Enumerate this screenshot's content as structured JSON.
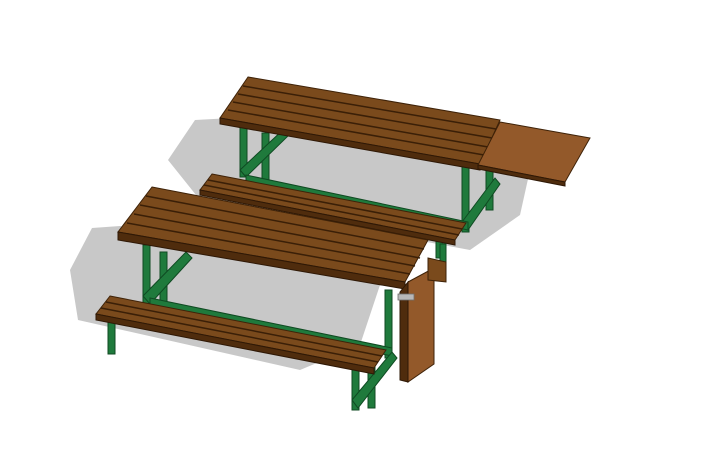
{
  "scene": {
    "subject": "",
    "colors": {
      "background": "#ffffff",
      "wood": "#7a4a1c",
      "wood_dark": "#4f2c0d",
      "wood_light": "#93592a",
      "frame": "#1f7a3c",
      "frame_dark": "#145a2a",
      "shadow": "#c8c8c8",
      "hardware": "#b8b8b8"
    }
  }
}
